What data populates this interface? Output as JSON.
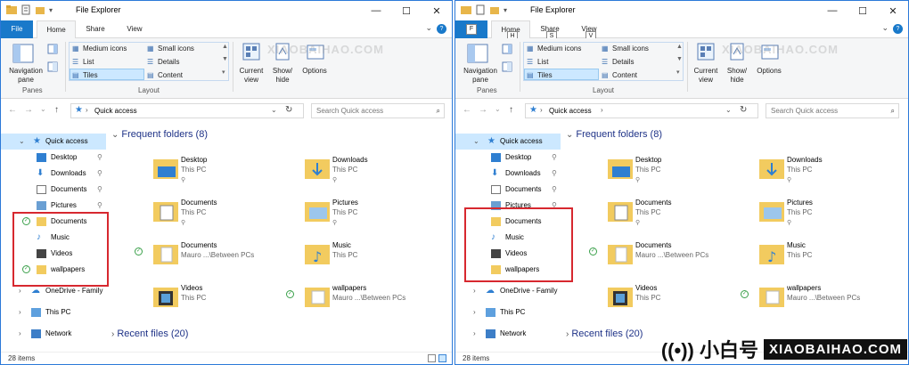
{
  "left_window": {
    "title": "File Explorer",
    "tabs": {
      "file": "File",
      "home": "Home",
      "share": "Share",
      "view": "View"
    },
    "help": "?",
    "ribbon": {
      "navigation_pane": "Navigation pane",
      "layouts": [
        "Medium icons",
        "Small icons",
        "List",
        "Details",
        "Tiles",
        "Content"
      ],
      "current_view": "Current view",
      "show_hide": "Show/ hide",
      "options": "Options",
      "group_panes": "Panes",
      "group_layout": "Layout"
    },
    "address": {
      "path": "Quick access",
      "search_placeholder": "Search Quick access"
    },
    "nav": {
      "quick_access": "Quick access",
      "pinned": [
        "Desktop",
        "Downloads",
        "Documents",
        "Pictures"
      ],
      "recent": [
        "Documents",
        "Music",
        "Videos",
        "wallpapers"
      ],
      "onedrive": "OneDrive - Family",
      "this_pc": "This PC",
      "network": "Network"
    },
    "frequent_header": "Frequent folders (8)",
    "recent_header": "Recent files (20)",
    "tiles": [
      {
        "name": "Desktop",
        "sub": "This PC"
      },
      {
        "name": "Downloads",
        "sub": "This PC"
      },
      {
        "name": "Documents",
        "sub": "This PC"
      },
      {
        "name": "Pictures",
        "sub": "This PC"
      },
      {
        "name": "Documents",
        "sub": "Mauro ...\\Between PCs"
      },
      {
        "name": "Music",
        "sub": "This PC"
      },
      {
        "name": "Videos",
        "sub": "This PC"
      },
      {
        "name": "wallpapers",
        "sub": "Mauro ...\\Between PCs"
      }
    ],
    "status": "28 items"
  },
  "right_window": {
    "title": "File Explorer",
    "keytips": {
      "file": "F",
      "home": "H",
      "share": "S",
      "view": "V"
    },
    "status": "28 items"
  },
  "watermark": {
    "site": "XIAOBAIHAO.COM",
    "cn": "小白号"
  },
  "colors": {
    "accent": "#1979ca",
    "highlight": "#d7282f",
    "link_blue": "#1e3287"
  }
}
